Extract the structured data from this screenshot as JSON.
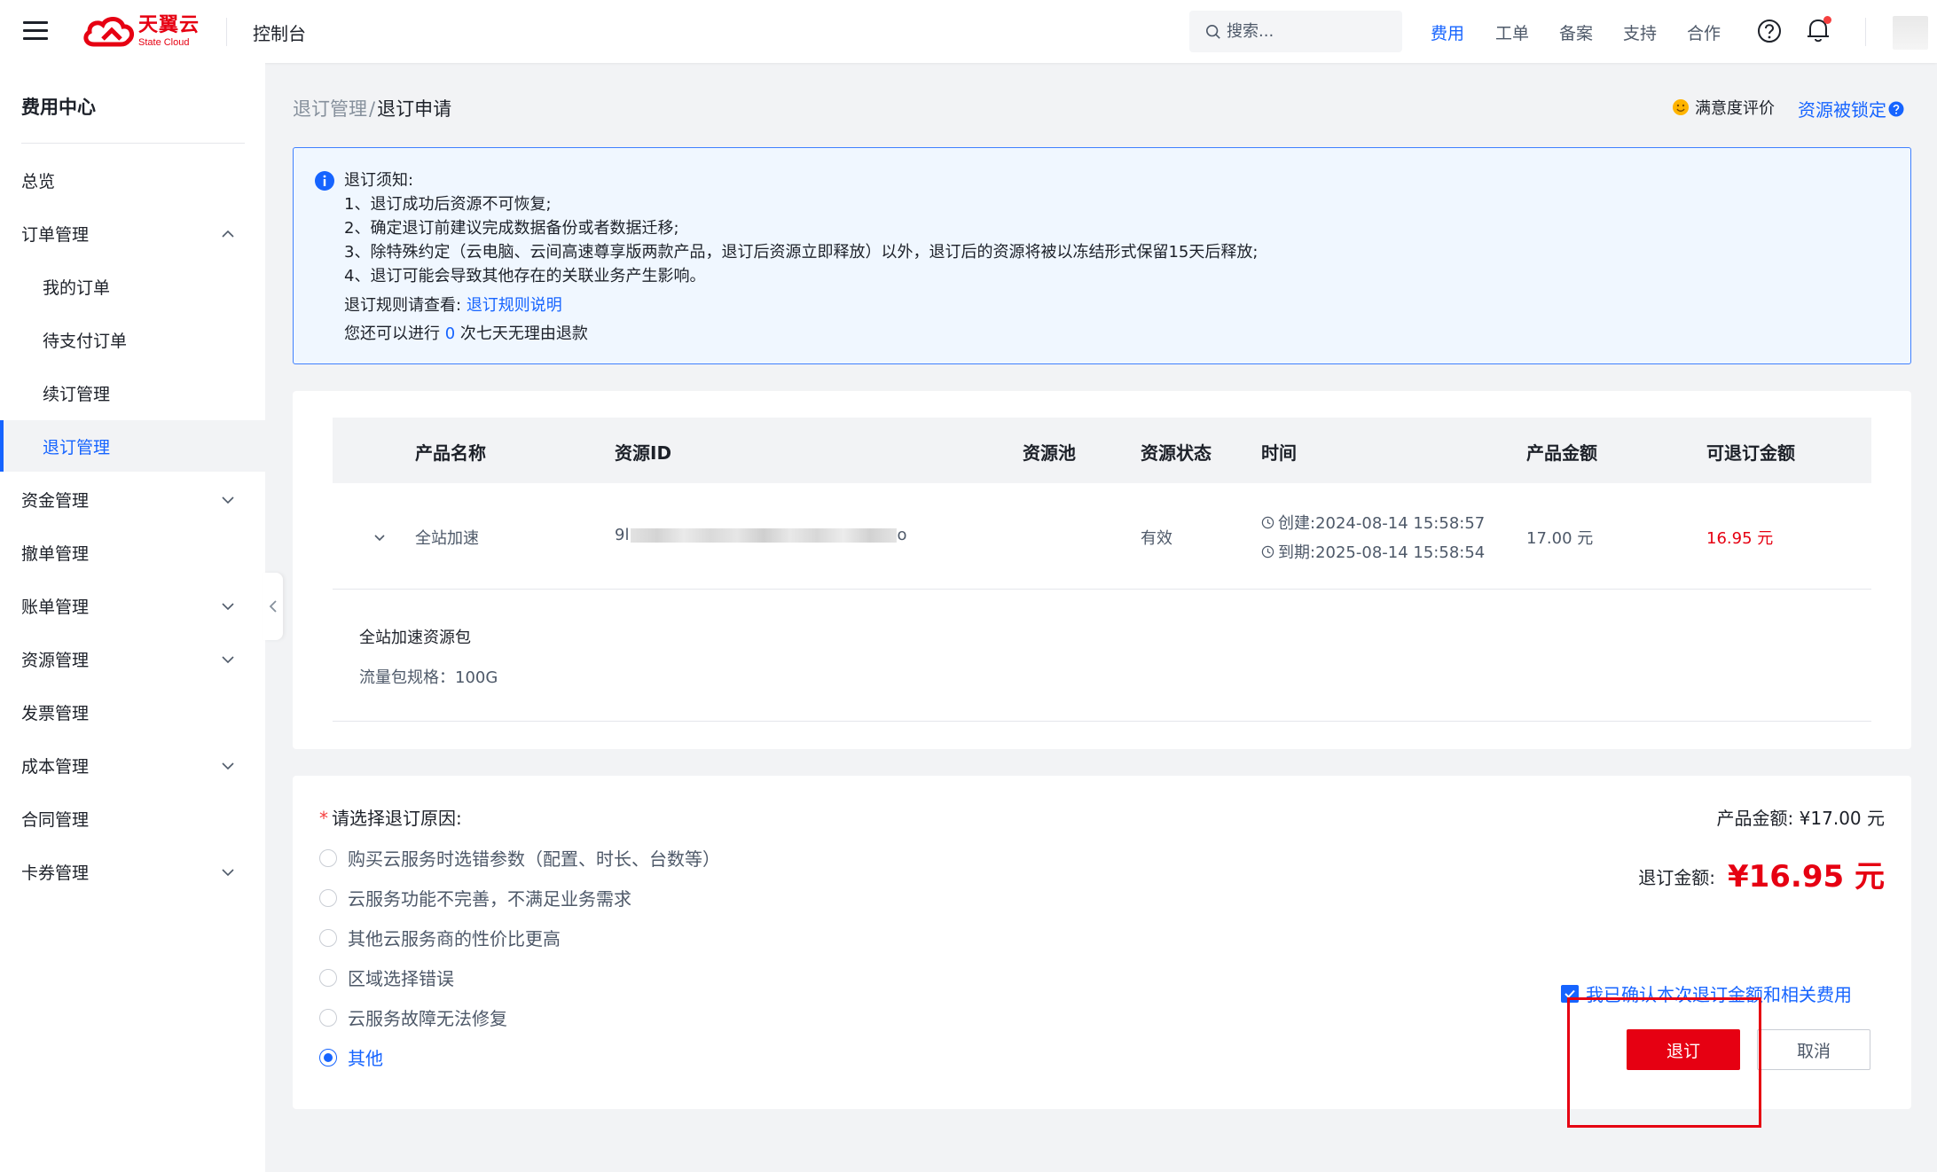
{
  "header": {
    "logo_cn": "天翼云",
    "logo_en": "State Cloud",
    "console_title": "控制台",
    "search_placeholder": "搜索...",
    "nav": [
      "费用",
      "工单",
      "备案",
      "支持",
      "合作"
    ],
    "active_nav": "费用"
  },
  "sidebar": {
    "title": "费用中心",
    "items": [
      {
        "label": "总览",
        "sub": false,
        "chevron": "none"
      },
      {
        "label": "订单管理",
        "sub": false,
        "chevron": "up"
      },
      {
        "label": "我的订单",
        "sub": true,
        "chevron": "none"
      },
      {
        "label": "待支付订单",
        "sub": true,
        "chevron": "none"
      },
      {
        "label": "续订管理",
        "sub": true,
        "chevron": "none"
      },
      {
        "label": "退订管理",
        "sub": true,
        "chevron": "none",
        "active": true
      },
      {
        "label": "资金管理",
        "sub": false,
        "chevron": "down"
      },
      {
        "label": "撤单管理",
        "sub": false,
        "chevron": "none"
      },
      {
        "label": "账单管理",
        "sub": false,
        "chevron": "down"
      },
      {
        "label": "资源管理",
        "sub": false,
        "chevron": "down"
      },
      {
        "label": "发票管理",
        "sub": false,
        "chevron": "none"
      },
      {
        "label": "成本管理",
        "sub": false,
        "chevron": "down"
      },
      {
        "label": "合同管理",
        "sub": false,
        "chevron": "none"
      },
      {
        "label": "卡券管理",
        "sub": false,
        "chevron": "down"
      }
    ]
  },
  "breadcrumb": {
    "parent": "退订管理",
    "separator": "/",
    "current": "退订申请"
  },
  "top_actions": {
    "satisfaction": "满意度评价",
    "locked": "资源被锁定"
  },
  "notice": {
    "title": "退订须知:",
    "lines": [
      "1、退订成功后资源不可恢复;",
      "2、确定退订前建议完成数据备份或者数据迁移;",
      "3、除特殊约定（云电脑、云间高速尊享版两款产品，退订后资源立即释放）以外，退订后的资源将被以冻结形式保留15天后释放;",
      "4、退订可能会导致其他存在的关联业务产生影响。"
    ],
    "rules_prefix": "退订规则请查看:",
    "rules_link": "退订规则说明",
    "refund_prefix": "您还可以进行",
    "refund_count": "0",
    "refund_suffix": "次七天无理由退款"
  },
  "table": {
    "headers": [
      "产品名称",
      "资源ID",
      "资源池",
      "资源状态",
      "时间",
      "产品金额",
      "可退订金额"
    ],
    "row": {
      "product": "全站加速",
      "resource_id_prefix": "9l",
      "resource_id_suffix": "o",
      "pool": "",
      "status": "有效",
      "created": "创建:2024-08-14 15:58:57",
      "expires": "到期:2025-08-14 15:58:54",
      "amount": "17.00 元",
      "refundable": "16.95 元"
    },
    "detail": {
      "name": "全站加速资源包",
      "spec": "流量包规格：100G"
    }
  },
  "reasons": {
    "title": "请选择退订原因:",
    "options": [
      "购买云服务时选错参数（配置、时长、台数等）",
      "云服务功能不完善，不满足业务需求",
      "其他云服务商的性价比更高",
      "区域选择错误",
      "云服务故障无法修复",
      "其他"
    ],
    "selected_index": 5
  },
  "summary": {
    "product_amount_label": "产品金额:",
    "product_amount": "¥17.00 元",
    "refund_amount_label": "退订金额:",
    "refund_amount": "¥16.95 元",
    "confirm_label": "我已确认本次退订金额和相关费用",
    "submit_label": "退订",
    "cancel_label": "取消"
  },
  "colors": {
    "brand_red": "#e60012",
    "primary_blue": "#1664ff"
  }
}
